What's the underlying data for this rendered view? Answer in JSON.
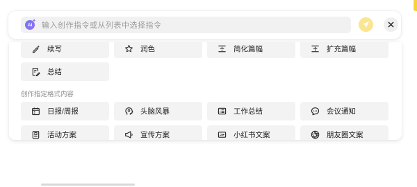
{
  "input": {
    "ai_badge": "AI",
    "placeholder": "输入创作指令或从列表中选择指令"
  },
  "chips_top": [
    {
      "label": "续写",
      "icon": "pen-sparkle-icon"
    },
    {
      "label": "润色",
      "icon": "star-sparkle-icon"
    },
    {
      "label": "简化篇幅",
      "icon": "compress-lines-icon"
    },
    {
      "label": "扩充篇幅",
      "icon": "expand-lines-icon"
    },
    {
      "label": "总结",
      "icon": "document-edit-icon"
    }
  ],
  "section_title": "创作指定格式内容",
  "chips_format": [
    {
      "label": "日报/周报",
      "icon": "calendar-icon"
    },
    {
      "label": "头脑风暴",
      "icon": "brain-icon"
    },
    {
      "label": "工作总结",
      "icon": "list-icon"
    },
    {
      "label": "会议通知",
      "icon": "chat-bubble-icon"
    },
    {
      "label": "活动方案",
      "icon": "clipboard-icon"
    },
    {
      "label": "宣传方案",
      "icon": "megaphone-icon"
    },
    {
      "label": "小红书文案",
      "icon": "xiaohongshu-icon"
    },
    {
      "label": "朋友圈文案",
      "icon": "aperture-icon"
    }
  ],
  "colors": {
    "accent": "#f7d33b",
    "send_bg": "#fbe590",
    "chip_bg": "#f3f3f3"
  }
}
